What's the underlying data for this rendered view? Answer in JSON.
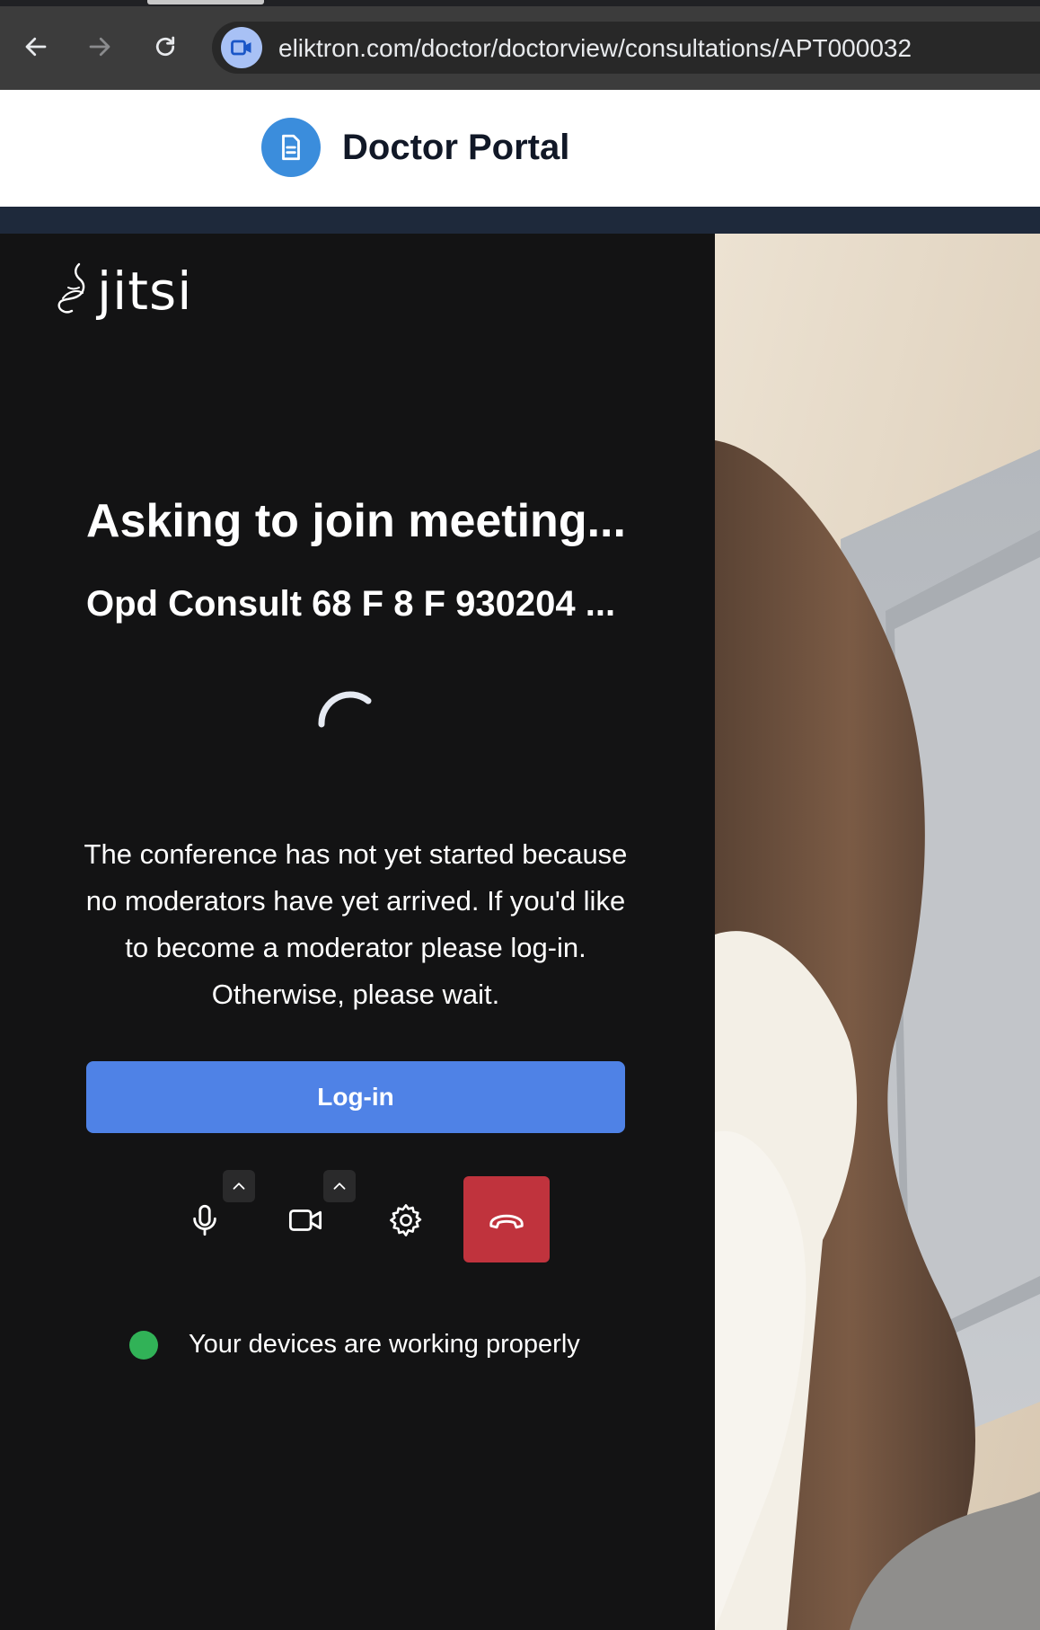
{
  "browser": {
    "url": "eliktron.com/doctor/doctorview/consultations/APT000032",
    "back_icon": "arrow-left-icon",
    "forward_icon": "arrow-right-icon",
    "reload_icon": "reload-icon",
    "site_icon": "video-camera-icon"
  },
  "portal": {
    "title": "Doctor Portal",
    "logo_icon": "document-icon",
    "accent_color": "#3b8ddc"
  },
  "prejoin": {
    "brand": "jitsi",
    "heading": "Asking to join meeting...",
    "meeting_name": "Opd Consult 68 F 8 F 930204 ...",
    "message": "The conference has not yet started because no moderators have yet arrived. If you'd like to become a moderator please log-in. Otherwise, please wait.",
    "login_label": "Log-in",
    "login_color": "#4f82e6",
    "toolbar": {
      "mic_icon": "microphone-icon",
      "camera_icon": "video-camera-icon",
      "settings_icon": "gear-icon",
      "hangup_icon": "hang-up-icon",
      "hangup_color": "#c0333d"
    },
    "device_status": "Your devices are working properly",
    "device_status_color": "#31b257"
  }
}
